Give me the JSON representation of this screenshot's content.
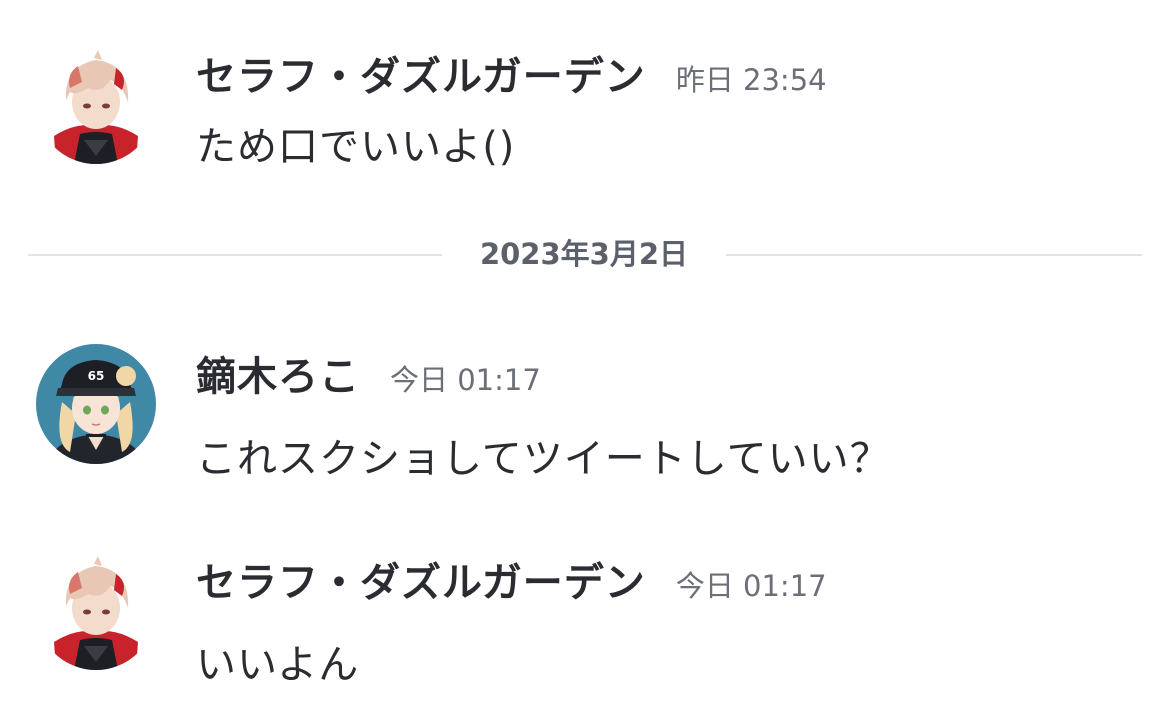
{
  "messages": [
    {
      "author": "セラフ・ダズルガーデン",
      "timestamp": "昨日 23:54",
      "text": "ため口でいいよ()",
      "avatar": "seraph-avatar"
    },
    {
      "author": "鏑木ろこ",
      "timestamp": "今日 01:17",
      "text": "これスクショしてツイートしていい？",
      "avatar": "roco-avatar"
    },
    {
      "author": "セラフ・ダズルガーデン",
      "timestamp": "今日 01:17",
      "text": "いいよん",
      "avatar": "seraph-avatar"
    }
  ],
  "date_divider": {
    "label": "2023年3月2日"
  },
  "colors": {
    "text": "#2a2c31",
    "timestamp": "#6b6f78",
    "divider_line": "#e1e3e7",
    "divider_text": "#5b606b"
  }
}
